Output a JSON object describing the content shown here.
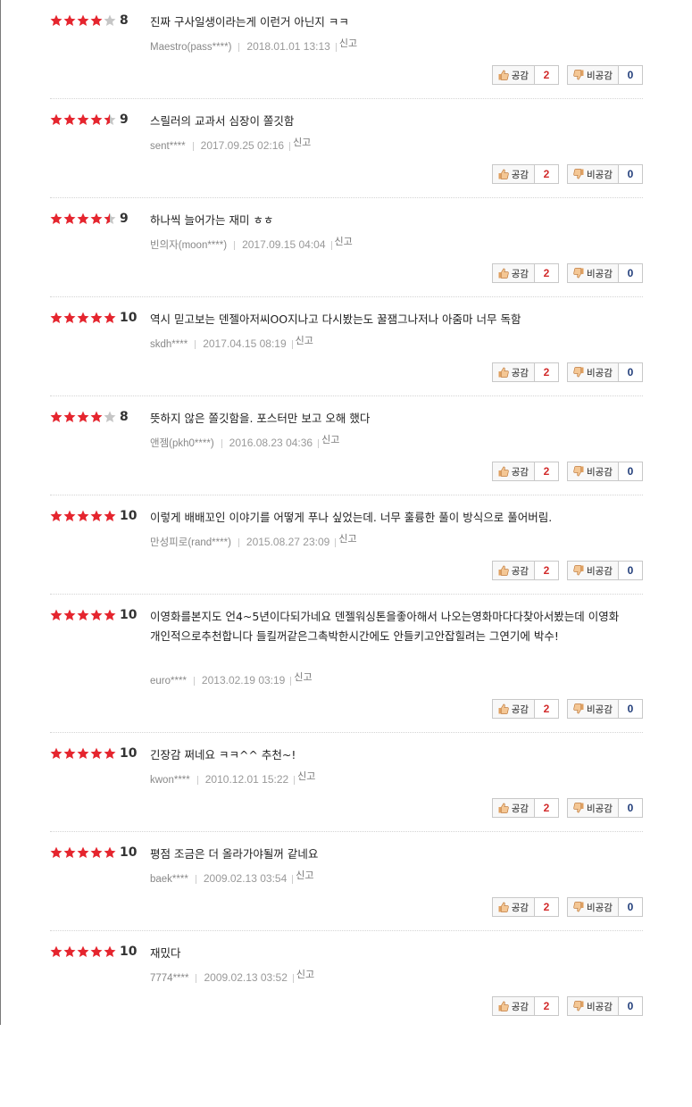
{
  "colors": {
    "star_on": "#e5252e",
    "star_off": "#c6c6c6",
    "sympathy_count": "#d22b2b",
    "antipathy_count": "#213d7a"
  },
  "icons": {
    "star": "star-icon",
    "half_star": "half-star-icon",
    "up": "thumbs-up-icon",
    "down": "thumbs-down-icon"
  },
  "labels": {
    "sympathy": "공감",
    "antipathy": "비공감",
    "report": "신고"
  },
  "reviews": [
    {
      "stars": 4,
      "score": "8",
      "text": "진짜 구사일생이라는게 이런거 아닌지 ㅋㅋ",
      "user": "Maestro(pass****)",
      "date": "2018.01.01 13:13",
      "up": "2",
      "down": "0"
    },
    {
      "stars": 4.5,
      "score": "9",
      "text": "스릴러의 교과서 심장이 쫄깃함",
      "user": "sent****",
      "date": "2017.09.25 02:16",
      "up": "2",
      "down": "0"
    },
    {
      "stars": 4.5,
      "score": "9",
      "text": "하나씩 늘어가는 재미 ㅎㅎ",
      "user": "빈의자(moon****)",
      "date": "2017.09.15 04:04",
      "up": "2",
      "down": "0"
    },
    {
      "stars": 5,
      "score": "10",
      "text": "역시 믿고보는 덴젤아저씨OO지나고 다시봤는도 꿀잼그나저나 아줌마 너무 독함",
      "user": "skdh****",
      "date": "2017.04.15 08:19",
      "up": "2",
      "down": "0"
    },
    {
      "stars": 4,
      "score": "8",
      "text": "뜻하지 않은 쫄깃함을. 포스터만 보고 오해 했다",
      "user": "앤젬(pkh0****)",
      "date": "2016.08.23 04:36",
      "up": "2",
      "down": "0"
    },
    {
      "stars": 5,
      "score": "10",
      "text": "이렇게 배배꼬인 이야기를 어떻게 푸나 싶었는데. 너무 훌륭한 풀이 방식으로 풀어버림.",
      "user": "만성피로(rand****)",
      "date": "2015.08.27 23:09",
      "up": "2",
      "down": "0"
    },
    {
      "stars": 5,
      "score": "10",
      "text": "이영화를본지도 언4~5년이다되가네요 덴젤워싱톤을좋아해서 나오는영화마다다찾아서봤는데 이영화개인적으로추천합니다 들킬꺼같은그촉박한시간에도 안들키고안잡힐려는 그연기에 박수!",
      "user": "euro****",
      "date": "2013.02.19 03:19",
      "up": "2",
      "down": "0"
    },
    {
      "stars": 5,
      "score": "10",
      "text": "긴장감 쩌네요 ㅋㅋ^^ 추천~!",
      "user": "kwon****",
      "date": "2010.12.01 15:22",
      "up": "2",
      "down": "0"
    },
    {
      "stars": 5,
      "score": "10",
      "text": "평점 조금은 더 올라가야될꺼 같네요",
      "user": "baek****",
      "date": "2009.02.13 03:54",
      "up": "2",
      "down": "0"
    },
    {
      "stars": 5,
      "score": "10",
      "text": "재밌다",
      "user": "7774****",
      "date": "2009.02.13 03:52",
      "up": "2",
      "down": "0"
    }
  ]
}
